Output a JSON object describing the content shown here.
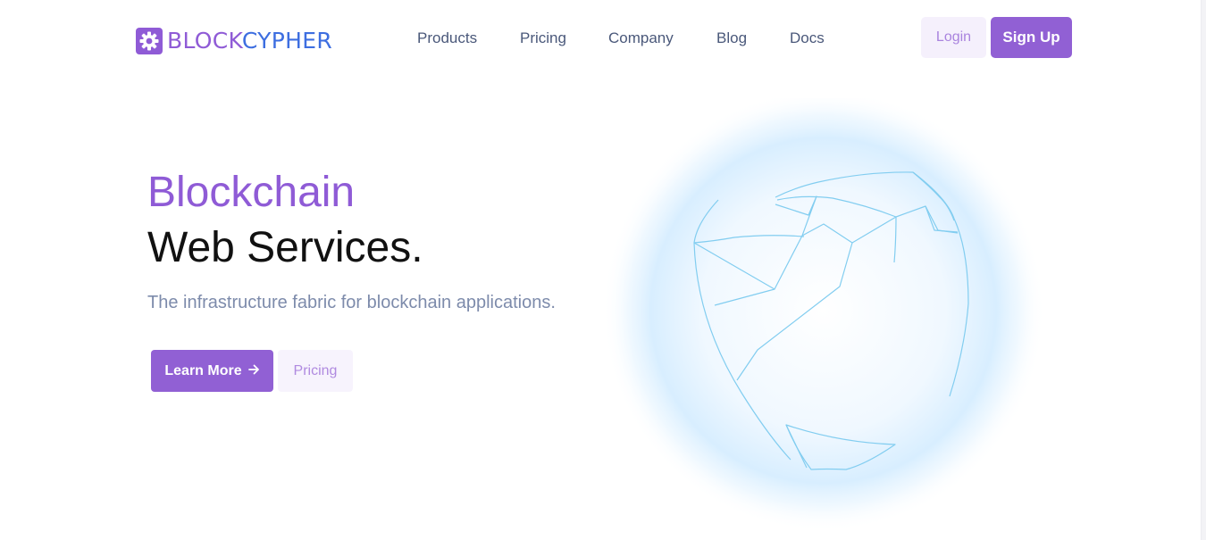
{
  "brand": {
    "name_part1": "BLOCK",
    "name_part2": "CYPHER",
    "icon": "gear-icon",
    "colors": {
      "purple": "#8f5bd6",
      "blue": "#3d6ee0"
    }
  },
  "nav": {
    "items": [
      {
        "label": "Products"
      },
      {
        "label": "Pricing"
      },
      {
        "label": "Company"
      },
      {
        "label": "Blog"
      },
      {
        "label": "Docs"
      }
    ]
  },
  "auth": {
    "login_label": "Login",
    "signup_label": "Sign Up"
  },
  "hero": {
    "title_line1": "Blockchain",
    "title_line2": "Web Services.",
    "subtitle": "The infrastructure fabric for blockchain applications.",
    "learn_more_label": "Learn More",
    "learn_more_icon": "arrow-right-icon",
    "pricing_label": "Pricing"
  },
  "illustration": {
    "name": "globe-wireframe",
    "colors": {
      "glow": "#cfe9ff",
      "lines": "#82cdf0"
    }
  }
}
